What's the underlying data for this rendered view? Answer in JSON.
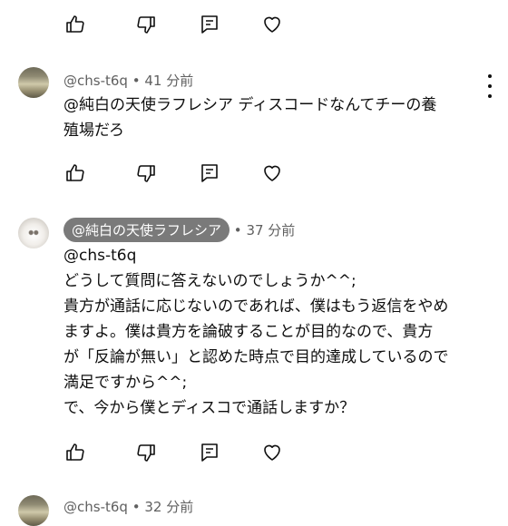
{
  "comments": [
    {
      "handle": "@chs-t6q",
      "time": "41 分前",
      "lines": [
        "@純白の天使ラフレシア  ディスコードなんてチーの養",
        "殖場だろ"
      ]
    },
    {
      "handle": "@純白の天使ラフレシア",
      "time": "37 分前",
      "lines": [
        "@chs-t6q",
        "どうして質問に答えないのでしょうか^^;",
        "貴方が通話に応じないのであれば、僕はもう返信をやめ",
        "ますよ。僕は貴方を論破することが目的なので、貴方",
        "が「反論が無い」と認めた時点で目的達成しているので",
        "満足ですから^^;",
        "で、今から僕とディスコで通話しますか？"
      ]
    },
    {
      "handle": "@chs-t6q",
      "time": "32 分前"
    }
  ],
  "separator": "•",
  "icons": {
    "like": "thumb-up-icon",
    "dislike": "thumb-down-icon",
    "reply": "reply-icon",
    "heart": "heart-icon",
    "more": "more-vert-icon"
  }
}
